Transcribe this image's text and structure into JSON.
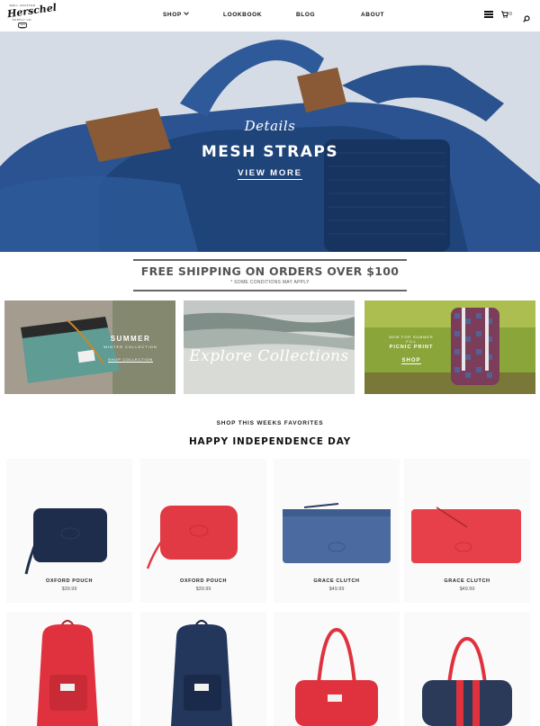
{
  "brand": {
    "tagline_top": "WELL CRAFTED",
    "name": "Herschel",
    "sub": "SUPPLY CO.",
    "seal": "TRADE MARK"
  },
  "nav": {
    "shop": "SHOP",
    "lookbook": "LOOKBOOK",
    "blog": "BLOG",
    "about": "ABOUT"
  },
  "header": {
    "cart_count": "0",
    "icons": [
      "menu-icon",
      "cart-icon",
      "search-icon"
    ]
  },
  "hero": {
    "script": "Details",
    "title": "MESH STRAPS",
    "link": "VIEW MORE"
  },
  "shipping": {
    "title": "FREE SHIPPING ON ORDERS OVER $100",
    "note": "* SOME CONDITIONS MAY APPLY"
  },
  "tiles": {
    "summer": {
      "title": "SUMMER",
      "sub": "WINTER COLLECTION",
      "link": "SHOP COLLECTION"
    },
    "explore": {
      "title": "Explore Collections"
    },
    "picnic": {
      "sub": "NEW FOR SUMMER FILL",
      "title": "PICNIC PRINT",
      "link": "SHOP"
    }
  },
  "section": {
    "eyebrow": "SHOP THIS WEEKS FAVORITES",
    "title": "HAPPY INDEPENDENCE DAY"
  },
  "products": [
    {
      "name": "OXFORD POUCH",
      "price": "$39.99",
      "color": "#1f2d4d"
    },
    {
      "name": "OXFORD POUCH",
      "price": "$39.99",
      "color": "#e23a44"
    },
    {
      "name": "GRACE CLUTCH",
      "price": "$49.99",
      "color": "#4a6aa0"
    },
    {
      "name": "GRACE CLUTCH",
      "price": "$49.99",
      "color": "#e8404a"
    },
    {
      "name": "",
      "price": "",
      "color": "#e0323e"
    },
    {
      "name": "",
      "price": "",
      "color": "#23365c"
    },
    {
      "name": "",
      "price": "",
      "color": "#e0323e"
    },
    {
      "name": "",
      "price": "",
      "color": "#2c3a5a"
    }
  ],
  "colors": {
    "navy": "#1f2d4d",
    "red": "#e23a44",
    "hero_blue": "#2d5694",
    "banner_text": "#555555"
  }
}
